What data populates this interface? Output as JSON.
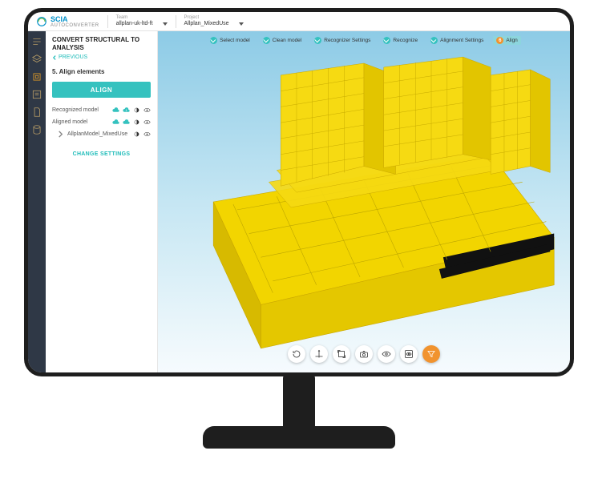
{
  "brand": {
    "name": "SCIA",
    "sub": "AUTOCONVERTER"
  },
  "menubar": {
    "team_label": "Team",
    "team_value": "allplan-uk-ltd-ft",
    "project_label": "Project",
    "project_value": "Allplan_MixedUse"
  },
  "rail": {
    "items": [
      "nav",
      "layers",
      "align",
      "list",
      "settings",
      "data"
    ]
  },
  "sidebar": {
    "title_line1": "CONVERT STRUCTURAL TO",
    "title_line2": "ANALYSIS",
    "previous": "PREVIOUS",
    "step_label": "5. Align elements",
    "align_button": "ALIGN",
    "row_recognized": "Recognized model",
    "row_aligned": "Aligned model",
    "row_file": "AllplanModel_MixedUse",
    "change_settings": "CHANGE SETTINGS"
  },
  "steps": [
    {
      "label": "Select model",
      "done": true
    },
    {
      "label": "Clean model",
      "done": true
    },
    {
      "label": "Recognizer Settings",
      "done": true
    },
    {
      "label": "Recognize",
      "done": true
    },
    {
      "label": "Alignment Settings",
      "done": true
    },
    {
      "label": "Align",
      "done": false,
      "active": true,
      "num": "6"
    }
  ],
  "toolbar": {
    "buttons": [
      "rotate",
      "reset-axes",
      "bbox",
      "camera",
      "eye",
      "eye-box",
      "filter"
    ]
  }
}
